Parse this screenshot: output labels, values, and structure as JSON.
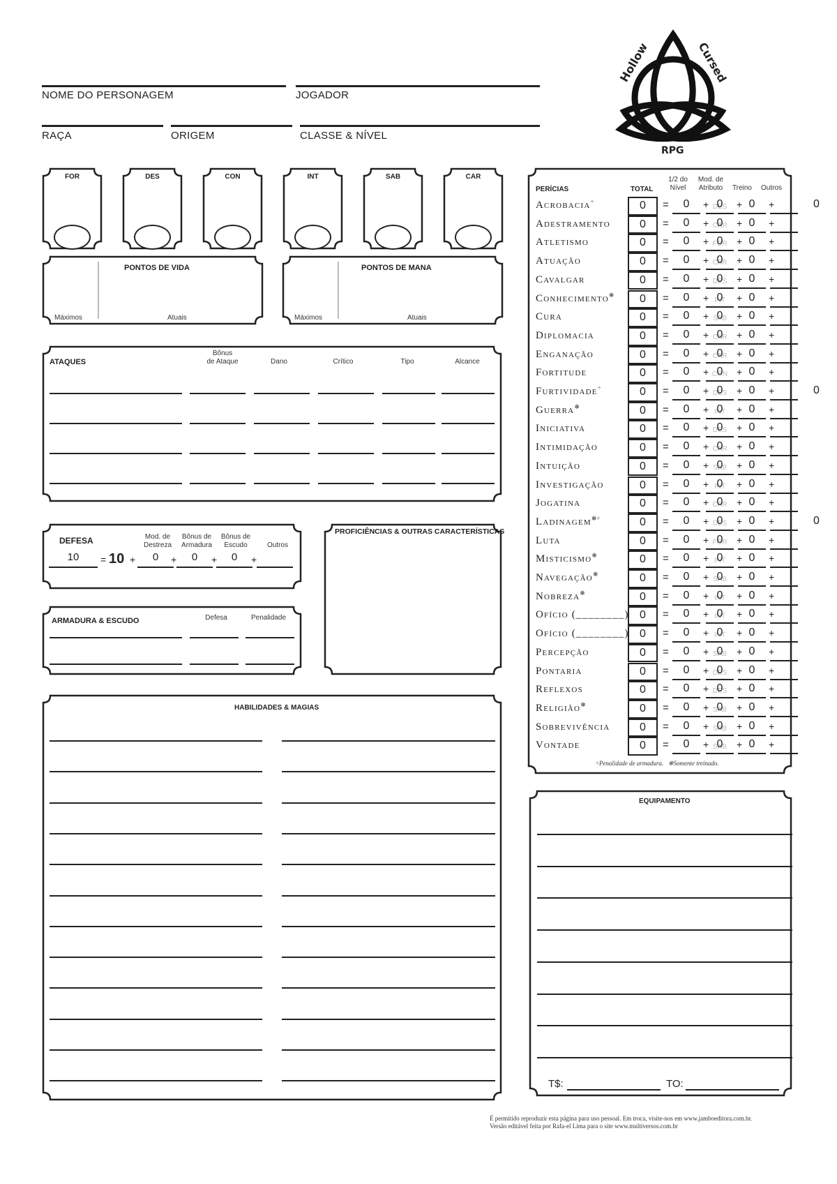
{
  "header": {
    "character_name_label": "NOME DO PERSONAGEM",
    "player_label": "JOGADOR",
    "race_label": "RAÇA",
    "origin_label": "ORIGEM",
    "class_level_label": "CLASSE & NÍVEL"
  },
  "logo": {
    "top_left": "Hollow",
    "top_right": "Cursed",
    "bottom": "RPG"
  },
  "attributes": [
    {
      "label": "FOR"
    },
    {
      "label": "DES"
    },
    {
      "label": "CON"
    },
    {
      "label": "INT"
    },
    {
      "label": "SAB"
    },
    {
      "label": "CAR"
    }
  ],
  "hit_points": {
    "title": "PONTOS DE VIDA",
    "max_label": "Máximos",
    "current_label": "Atuais"
  },
  "mana_points": {
    "title": "PONTOS DE MANA",
    "max_label": "Máximos",
    "current_label": "Atuais"
  },
  "attacks": {
    "title": "ATAQUES",
    "columns": [
      "Bônus de Ataque",
      "Dano",
      "Crítico",
      "Tipo",
      "Alcance"
    ],
    "column_bonus_line1": "Bônus",
    "column_bonus_line2": "de Ataque",
    "rows": 4
  },
  "defense": {
    "title": "DEFESA",
    "total": "10",
    "base": "10",
    "columns": [
      {
        "line1": "Mod. de",
        "line2": "Destreza",
        "value": "0"
      },
      {
        "line1": "Bônus de",
        "line2": "Armadura",
        "value": "0"
      },
      {
        "line1": "Bônus de",
        "line2": "Escudo",
        "value": "0"
      },
      {
        "line1": "",
        "line2": "Outros",
        "value": ""
      }
    ]
  },
  "armor": {
    "title": "ARMADURA & ESCUDO",
    "defense_label": "Defesa",
    "penalty_label": "Penalidade"
  },
  "proficiencies": {
    "title": "PROFICIÊNCIAS & OUTRAS CARACTERÍSTICAS"
  },
  "abilities": {
    "title": "HABILIDADES & MAGIAS"
  },
  "skills": {
    "title": "PERÍCIAS",
    "col_total": "TOTAL",
    "col_half_level_1": "1/2 do",
    "col_half_level_2": "Nível",
    "col_attr_1": "Mod. de",
    "col_attr_2": "Atributo",
    "col_training": "Treino",
    "col_other": "Outros",
    "footnote_armor": "÷Penalidade de armadura.",
    "footnote_trained": "❄Somente treinado.",
    "items": [
      {
        "name": "Acrobacia",
        "mark": "÷",
        "attr": "DES",
        "total": "0",
        "half": "0",
        "mod": "0",
        "train": "0",
        "penalty": "0"
      },
      {
        "name": "Adestramento",
        "mark": "",
        "attr": "CAR",
        "total": "0",
        "half": "0",
        "mod": "0",
        "train": "0",
        "penalty": ""
      },
      {
        "name": "Atletismo",
        "mark": "",
        "attr": "FOR",
        "total": "0",
        "half": "0",
        "mod": "0",
        "train": "0",
        "penalty": ""
      },
      {
        "name": "Atuação",
        "mark": "",
        "attr": "CAR",
        "total": "0",
        "half": "0",
        "mod": "0",
        "train": "0",
        "penalty": ""
      },
      {
        "name": "Cavalgar",
        "mark": "",
        "attr": "DES",
        "total": "0",
        "half": "0",
        "mod": "0",
        "train": "0",
        "penalty": ""
      },
      {
        "name": "Conhecimento",
        "mark": "❄",
        "attr": "INT",
        "total": "0",
        "half": "0",
        "mod": "0",
        "train": "0",
        "penalty": ""
      },
      {
        "name": "Cura",
        "mark": "",
        "attr": "SAB",
        "total": "0",
        "half": "0",
        "mod": "0",
        "train": "0",
        "penalty": ""
      },
      {
        "name": "Diplomacia",
        "mark": "",
        "attr": "CAR",
        "total": "0",
        "half": "0",
        "mod": "0",
        "train": "0",
        "penalty": ""
      },
      {
        "name": "Enganação",
        "mark": "",
        "attr": "CAR",
        "total": "0",
        "half": "0",
        "mod": "0",
        "train": "0",
        "penalty": ""
      },
      {
        "name": "Fortitude",
        "mark": "",
        "attr": "CON",
        "total": "0",
        "half": "0",
        "mod": "0",
        "train": "0",
        "penalty": ""
      },
      {
        "name": "Furtividade",
        "mark": "÷",
        "attr": "DES",
        "total": "0",
        "half": "0",
        "mod": "0",
        "train": "0",
        "penalty": "0"
      },
      {
        "name": "Guerra",
        "mark": "❄",
        "attr": "INT",
        "total": "0",
        "half": "0",
        "mod": "0",
        "train": "0",
        "penalty": ""
      },
      {
        "name": "Iniciativa",
        "mark": "",
        "attr": "DES",
        "total": "0",
        "half": "0",
        "mod": "0",
        "train": "0",
        "penalty": ""
      },
      {
        "name": "Intimidação",
        "mark": "",
        "attr": "CAR",
        "total": "0",
        "half": "0",
        "mod": "0",
        "train": "0",
        "penalty": ""
      },
      {
        "name": "Intuição",
        "mark": "",
        "attr": "SAB",
        "total": "0",
        "half": "0",
        "mod": "0",
        "train": "0",
        "penalty": ""
      },
      {
        "name": "Investigação",
        "mark": "",
        "attr": "INT",
        "total": "0",
        "half": "0",
        "mod": "0",
        "train": "0",
        "penalty": ""
      },
      {
        "name": "Jogatina",
        "mark": "",
        "attr": "CAR",
        "total": "0",
        "half": "0",
        "mod": "0",
        "train": "0",
        "penalty": ""
      },
      {
        "name": "Ladinagem",
        "mark": "❄÷",
        "attr": "DES",
        "total": "0",
        "half": "0",
        "mod": "0",
        "train": "0",
        "penalty": "0"
      },
      {
        "name": "Luta",
        "mark": "",
        "attr": "FOR",
        "total": "0",
        "half": "0",
        "mod": "0",
        "train": "0",
        "penalty": ""
      },
      {
        "name": "Misticismo",
        "mark": "❄",
        "attr": "INT",
        "total": "0",
        "half": "0",
        "mod": "0",
        "train": "0",
        "penalty": ""
      },
      {
        "name": "Navegação",
        "mark": "❄",
        "attr": "SAB",
        "total": "0",
        "half": "0",
        "mod": "0",
        "train": "0",
        "penalty": ""
      },
      {
        "name": "Nobreza",
        "mark": "❄",
        "attr": "INT",
        "total": "0",
        "half": "0",
        "mod": "0",
        "train": "0",
        "penalty": ""
      },
      {
        "name": "Ofício (________)",
        "mark": "",
        "attr": "INT",
        "total": "0",
        "half": "0",
        "mod": "0",
        "train": "0",
        "penalty": ""
      },
      {
        "name": "Ofício (________)",
        "mark": "",
        "attr": "INT",
        "total": "0",
        "half": "0",
        "mod": "0",
        "train": "0",
        "penalty": ""
      },
      {
        "name": "Percepção",
        "mark": "",
        "attr": "SAB",
        "total": "0",
        "half": "0",
        "mod": "0",
        "train": "0",
        "penalty": ""
      },
      {
        "name": "Pontaria",
        "mark": "",
        "attr": "DES",
        "total": "0",
        "half": "0",
        "mod": "0",
        "train": "0",
        "penalty": ""
      },
      {
        "name": "Reflexos",
        "mark": "",
        "attr": "DES",
        "total": "0",
        "half": "0",
        "mod": "0",
        "train": "0",
        "penalty": ""
      },
      {
        "name": "Religião",
        "mark": "❄",
        "attr": "SAB",
        "total": "0",
        "half": "0",
        "mod": "0",
        "train": "0",
        "penalty": ""
      },
      {
        "name": "Sobrevivência",
        "mark": "",
        "attr": "SAB",
        "total": "0",
        "half": "0",
        "mod": "0",
        "train": "0",
        "penalty": ""
      },
      {
        "name": "Vontade",
        "mark": "",
        "attr": "SAB",
        "total": "0",
        "half": "0",
        "mod": "0",
        "train": "0",
        "penalty": ""
      }
    ]
  },
  "equipment": {
    "title": "EQUIPAMENTO",
    "money_label": "T$:",
    "gold_label": "TO:",
    "lines": 8
  },
  "footer": {
    "line1": "É permitido reproduzir esta página para uso pessoal. Em troca, visite-nos em www.jamboeditora.com.br.",
    "line2": "Versão editável feita por Rafa-el Lima para o site www.multiversos.com.br"
  }
}
